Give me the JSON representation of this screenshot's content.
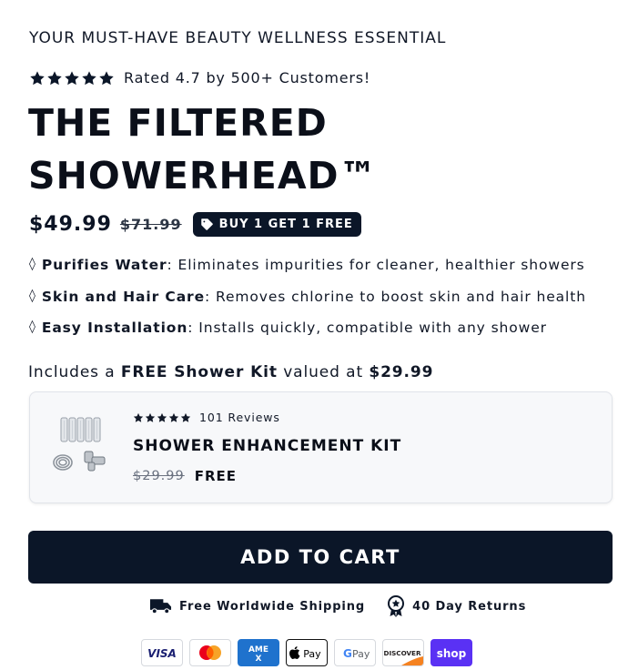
{
  "eyebrow": "YOUR MUST-HAVE BEAUTY WELLNESS ESSENTIAL",
  "rating": {
    "stars": 5,
    "text": "Rated 4.7 by 500+ Customers!",
    "star_color": "#0b1628"
  },
  "product": {
    "title": "THE FILTERED SHOWERHEAD™",
    "price": "$49.99",
    "compare_price": "$71.99",
    "badge": "BUY 1 GET 1 FREE",
    "badge_icon": "tag-icon"
  },
  "benefits": [
    {
      "bullet": "◊",
      "title": "Purifies Water",
      "text": ": Eliminates impurities for cleaner, healthier showers"
    },
    {
      "bullet": "◊",
      "title": "Skin and Hair Care",
      "text": ": Removes chlorine to boost skin and hair health"
    },
    {
      "bullet": "◊",
      "title": "Easy Installation",
      "text": ": Installs quickly, compatible with any shower"
    }
  ],
  "kit_intro": {
    "prefix": "Includes a ",
    "highlight": "FREE Shower Kit",
    "middle": " valued at ",
    "value": "$29.99"
  },
  "kit": {
    "reviews": "101 Reviews",
    "name": "SHOWER ENHANCEMENT KIT",
    "old_price": "$29.99",
    "price": "FREE",
    "image_icon": "shower-kit-image"
  },
  "add_to_cart": "ADD TO CART",
  "assurances": {
    "shipping": "Free Worldwide Shipping",
    "shipping_icon": "truck-icon",
    "returns": "40 Day Returns",
    "returns_icon": "award-icon"
  },
  "payments": [
    "VISA",
    "Mastercard",
    "AMEX",
    "Apple Pay",
    "G Pay",
    "DISCOVER",
    "shop"
  ],
  "colors": {
    "primary": "#0b1628",
    "text": "#111827",
    "card_bg": "#f7f8fa",
    "shop_pay": "#5a31f4",
    "amex": "#1f72cd",
    "visa": "#1a1f71"
  }
}
